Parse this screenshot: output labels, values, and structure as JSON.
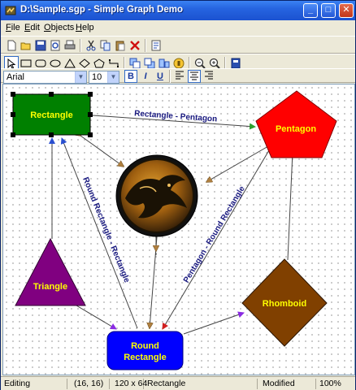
{
  "window": {
    "title": "D:\\Sample.sgp - Simple Graph Demo"
  },
  "menu": [
    "File",
    "Edit",
    "Objects",
    "Help"
  ],
  "menu_underline": [
    "F",
    "E",
    "O",
    "H"
  ],
  "format_bar": {
    "font": "Arial",
    "size": "10"
  },
  "diagram": {
    "nodes": {
      "rectangle": "Rectangle",
      "pentagon": "Pentagon",
      "triangle": "Triangle",
      "round_rectangle_line1": "Round",
      "round_rectangle_line2": "Rectangle",
      "rhomboid": "Rhomboid"
    },
    "links": {
      "rect_pentagon": "Rectangle - Pentagon",
      "roundrect_rect": "Round Rectangle - Rectangle",
      "pentagon_roundrect": "Pentagon - Round Rectangle"
    },
    "colors": {
      "rectangle": "#008000",
      "pentagon": "#ff0000",
      "triangle": "#800080",
      "round_rectangle": "#0000ff",
      "rhomboid": "#804000",
      "node_text": "#ffff00",
      "link_text": "#1a1a80"
    }
  },
  "status": {
    "mode": "Editing",
    "position": "(16, 16)",
    "size": "120 x 64",
    "shape": "Rectangle",
    "state": "Modified",
    "zoom": "100%"
  }
}
